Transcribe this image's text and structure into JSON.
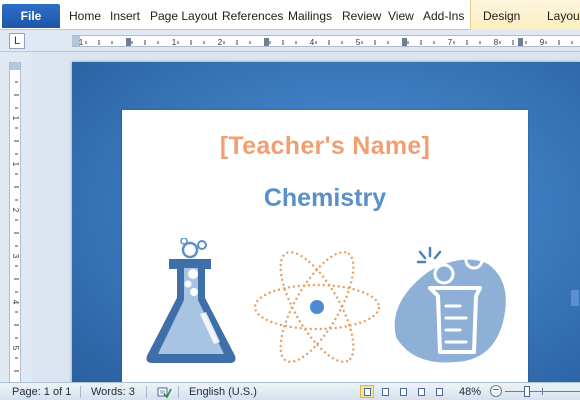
{
  "ribbon": {
    "file": "File",
    "tabs": [
      "Home",
      "Insert",
      "Page Layout",
      "References",
      "Mailings",
      "Review",
      "View",
      "Add-Ins"
    ],
    "contextual_tabs": [
      "Design",
      "Layout"
    ]
  },
  "ruler": {
    "tab_selector_glyph": "L"
  },
  "document": {
    "teacher_name": "[Teacher's Name]",
    "subject": "Chemistry",
    "illustrations": [
      "flask-icon",
      "atom-icon",
      "beaker-icon"
    ],
    "colors": {
      "name": "#f0a070",
      "subject": "#5a90c8",
      "background": "#3d7cc0"
    }
  },
  "status": {
    "page": "Page: 1 of 1",
    "words": "Words: 3",
    "language": "English (U.S.)",
    "zoom": "48%",
    "zoom_out": "−",
    "active_view": "print-layout"
  }
}
